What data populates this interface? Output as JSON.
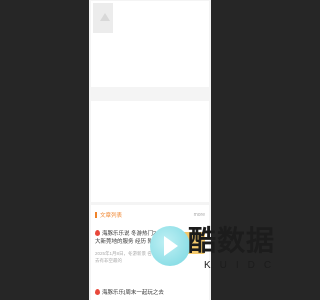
{
  "header": {
    "menu_icon": "menu-icon",
    "image_icon": "image-placeholder-icon"
  },
  "section": {
    "title": "文章列表",
    "more_label": "more"
  },
  "articles": [
    {
      "title": "海豚乐乐说 冬游热门2025年大新莞地的服务 经历 附游主",
      "desc": "2025年1月8日，冬游新景 名字 先先去有非空最的",
      "icon": "hot-icon"
    },
    {
      "title": "海豚乐乐|周末一起玩之去",
      "desc": "",
      "icon": "hot-icon"
    }
  ],
  "watermark": {
    "text": "酷数据",
    "sub": "KUIDC"
  },
  "colors": {
    "accent": "#f0832a",
    "hot": "#e8483b",
    "backdrop": "#262626"
  }
}
